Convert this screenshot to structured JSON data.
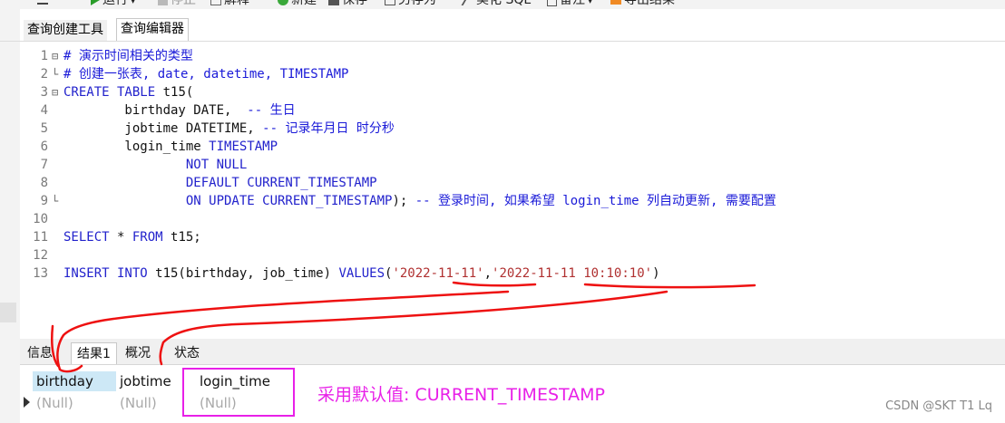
{
  "toolbar": {
    "run": "运行",
    "stop": "停止",
    "explain": "解释",
    "new": "新建",
    "save": "保存",
    "save_as": "另存为",
    "beautify": "美化 SQL",
    "comment": "备注",
    "export": "导出结果"
  },
  "top_tabs": [
    "查询创建工具",
    "查询编辑器"
  ],
  "editor": {
    "lines": [
      {
        "n": "1",
        "parts": [
          {
            "c": "cm",
            "t": "# 演示时间相关的类型"
          }
        ]
      },
      {
        "n": "2",
        "parts": [
          {
            "c": "cm",
            "t": "# 创建一张表, date, datetime, TIMESTAMP"
          }
        ]
      },
      {
        "n": "3",
        "parts": [
          {
            "c": "kw",
            "t": "CREATE TABLE"
          },
          {
            "c": "tx",
            "t": " t15("
          }
        ]
      },
      {
        "n": "4",
        "parts": [
          {
            "c": "tx",
            "t": "        birthday DATE,  "
          },
          {
            "c": "cm",
            "t": "-- 生日"
          }
        ]
      },
      {
        "n": "5",
        "parts": [
          {
            "c": "tx",
            "t": "        jobtime DATETIME, "
          },
          {
            "c": "cm",
            "t": "-- 记录年月日 时分秒"
          }
        ]
      },
      {
        "n": "6",
        "parts": [
          {
            "c": "tx",
            "t": "        login_time "
          },
          {
            "c": "kw",
            "t": "TIMESTAMP"
          }
        ]
      },
      {
        "n": "7",
        "parts": [
          {
            "c": "kw",
            "t": "                NOT NULL"
          }
        ]
      },
      {
        "n": "8",
        "parts": [
          {
            "c": "kw",
            "t": "                DEFAULT CURRENT_TIMESTAMP"
          }
        ]
      },
      {
        "n": "9",
        "parts": [
          {
            "c": "kw",
            "t": "                ON UPDATE CURRENT_TIMESTAMP"
          },
          {
            "c": "tx",
            "t": "); "
          },
          {
            "c": "cm",
            "t": "-- 登录时间, 如果希望 login_time 列自动更新, 需要配置"
          }
        ]
      },
      {
        "n": "10",
        "parts": []
      },
      {
        "n": "11",
        "parts": [
          {
            "c": "kw",
            "t": "SELECT"
          },
          {
            "c": "tx",
            "t": " * "
          },
          {
            "c": "kw",
            "t": "FROM"
          },
          {
            "c": "tx",
            "t": " t15;"
          }
        ]
      },
      {
        "n": "12",
        "parts": []
      },
      {
        "n": "13",
        "parts": [
          {
            "c": "kw",
            "t": "INSERT INTO"
          },
          {
            "c": "tx",
            "t": " t15(birthday, job_time) "
          },
          {
            "c": "kw",
            "t": "VALUES"
          },
          {
            "c": "tx",
            "t": "("
          },
          {
            "c": "str",
            "t": "'2022-11-11'"
          },
          {
            "c": "tx",
            "t": ","
          },
          {
            "c": "str",
            "t": "'2022-11-11 10:10:10'"
          },
          {
            "c": "tx",
            "t": ")"
          }
        ]
      }
    ]
  },
  "result_tabs": [
    "信息",
    "结果1",
    "概况",
    "状态"
  ],
  "grid": {
    "columns": [
      "birthday",
      "jobtime",
      "login_time"
    ],
    "row": [
      "(Null)",
      "(Null)",
      "(Null)"
    ]
  },
  "annotation": "采用默认值: CURRENT_TIMESTAMP",
  "watermark": "CSDN @SKT T1 Lq",
  "colors": {
    "keyword": "#2222cc",
    "comment": "#1a1ad8",
    "string": "#b03030",
    "annotation": "#e820e8",
    "red_marks": "#ee1111"
  }
}
